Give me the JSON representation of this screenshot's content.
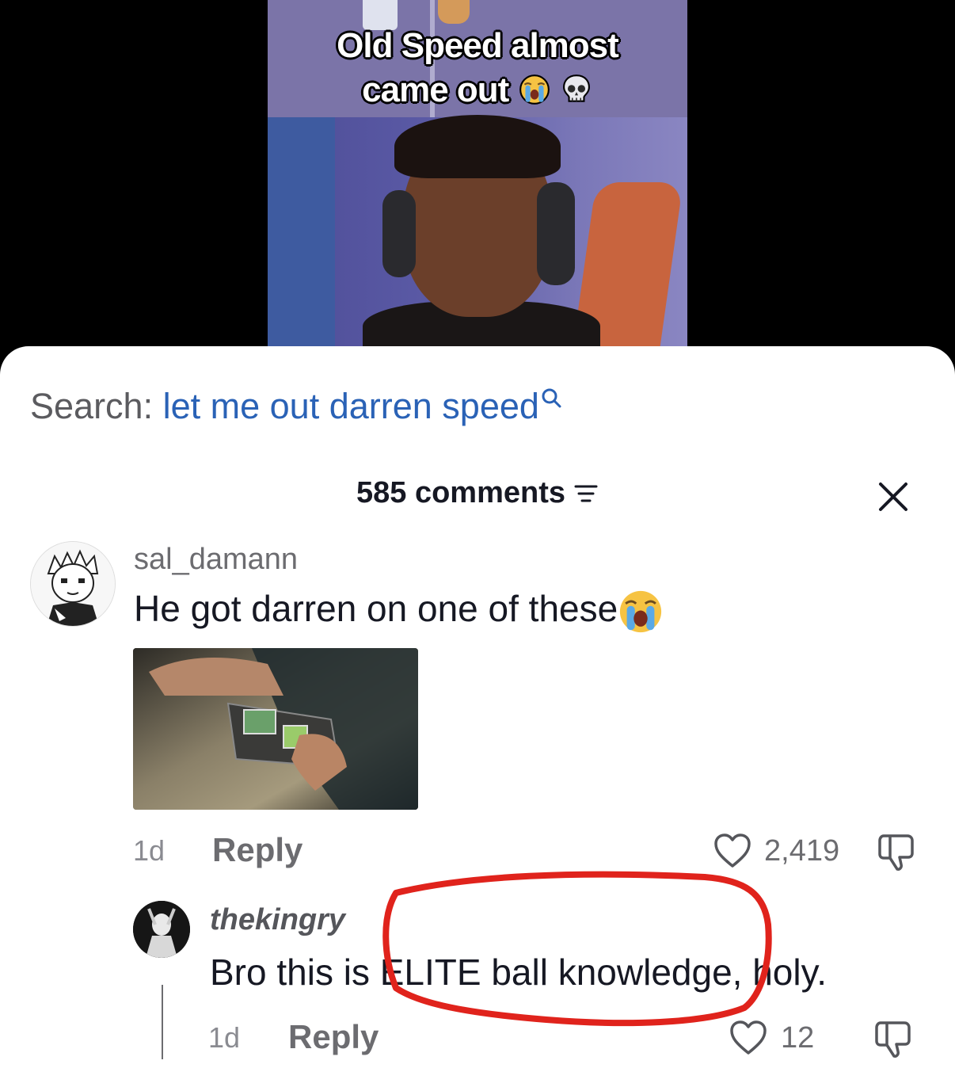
{
  "video": {
    "caption_line1": "Old Speed almost",
    "caption_line2": "came out"
  },
  "search": {
    "label": "Search:",
    "query": "let me out darren speed"
  },
  "comments_header": {
    "count_label": "585 comments"
  },
  "comments": [
    {
      "username": "sal_damann",
      "text": "He got darren on one of these",
      "emoji": "loudly-crying-face",
      "time": "1d",
      "reply_label": "Reply",
      "likes": "2,419"
    },
    {
      "username": "thekingry",
      "text": "Bro this is ELITE ball knowledge, holy.",
      "time": "1d",
      "reply_label": "Reply",
      "likes": "12"
    }
  ],
  "colors": {
    "search_query": "#2a62b6",
    "annotation": "#e0231c"
  }
}
